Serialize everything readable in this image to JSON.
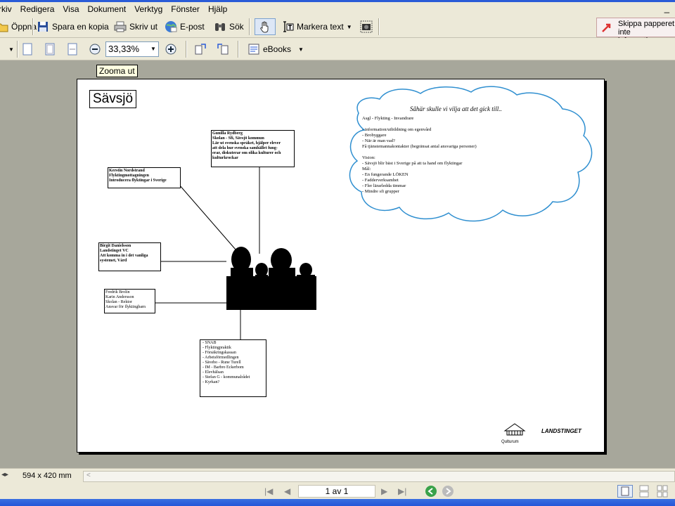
{
  "menu": {
    "items": [
      "rkiv",
      "Redigera",
      "Visa",
      "Dokument",
      "Verktyg",
      "Fönster",
      "Hjälp"
    ],
    "minimize": "_"
  },
  "toolbar1": {
    "open": "Öppna",
    "save_copy": "Spara en kopia",
    "print": "Skriv ut",
    "email": "E-post",
    "search": "Sök",
    "select_text": "Markera text",
    "skip_line1": "Skippa papperet",
    "skip_line2": "inte informatione"
  },
  "toolbar2": {
    "zoom": "33,33%",
    "ebooks": "eBooks"
  },
  "tooltip": "Zooma ut",
  "document": {
    "title": "Sävsjö",
    "boxes": {
      "gunilla": {
        "name": "Gunilla Rydberg",
        "lines": [
          "Skolan - Sfi, Sävsjö kommun",
          "Lär ut svenska språket, hjälper elever",
          "att dela hur svenska samhället fung-",
          "erar, diskuterar om olika kulturer och",
          "kulturkrockar"
        ]
      },
      "kerstin": {
        "name": "Kerstin Nordstrand",
        "lines": [
          "Flyktingmottagningen",
          "Introducera flyktingar i Sverige"
        ]
      },
      "birgit": {
        "name": "Birgit Danielsson",
        "lines": [
          "Landstinget VC",
          "Att komma in i det vanliga",
          "systemet, Vård"
        ]
      },
      "fredrik": {
        "name": "Fredrik Brolin",
        "lines": [
          "Karin Andersson",
          "Skolan - Rektor",
          "Ansvar för flyktingbarn"
        ]
      },
      "snab": {
        "lines": [
          "- SNAB",
          "- Flyktingpraktik",
          "- Försäkringskassan",
          "- Arbetsförmedlingen",
          "- Sävebo - Rune Turell",
          "- IM - Barbro Eckerbom",
          "- Elevhälsan",
          "- Stefan G - kommunalrådet",
          "- Kyrkan?"
        ]
      }
    },
    "cloud": {
      "title": "Såhär skulle vi vilja att det gick till..",
      "lines": [
        "Asgl - Flykting - Invandrare",
        "",
        "- information/utbildning om egenvård",
        "- Brobyggare",
        "- När är man vad?",
        "Få tjänstemannakontakter (begränsat antal ansvariga personer)",
        "",
        "Vision:",
        "- Sävsjö blir bäst i Sverige på att ta hand om flyktingar",
        "Mål:",
        "- En fungerande LÖKEN",
        "- Fadderverksamhet",
        "- Fler lärarledda timmar",
        "- Mindre sfi grupper"
      ]
    },
    "logo1": "Qulturum",
    "logo2": "LANDSTINGET"
  },
  "status": {
    "page_size": "594 x 420 mm"
  },
  "nav": {
    "page_indicator": "1 av 1"
  },
  "colors": {
    "chrome": "#ece9d8",
    "workspace": "#a7a79b",
    "cloud_stroke": "#2f8fd0"
  }
}
